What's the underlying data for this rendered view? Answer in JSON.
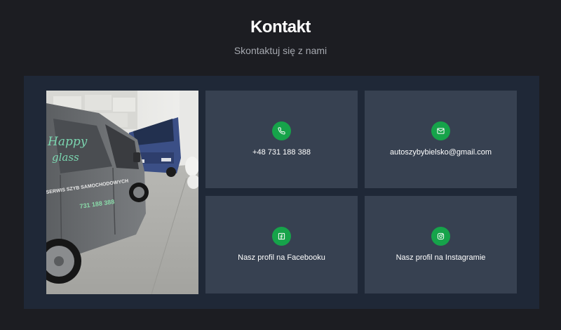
{
  "section": {
    "title": "Kontakt",
    "subtitle": "Skontaktuj się z nami"
  },
  "contacts": [
    {
      "icon": "phone-icon",
      "label": "+48 731 188 388"
    },
    {
      "icon": "mail-icon",
      "label": "autoszybybielsko@gmail.com"
    },
    {
      "icon": "facebook-icon",
      "label": "Nasz profil na Facebooku"
    },
    {
      "icon": "instagram-icon",
      "label": "Nasz profil na Instagramie"
    }
  ],
  "photo": {
    "van_lettering": "Happy glass",
    "van_text": "SERWIS SZYB SAMOCHODOWYCH",
    "van_phone": "731 188 388"
  },
  "colors": {
    "background": "#1c1d22",
    "panel": "#1f2837",
    "card": "#374151",
    "accent": "#16a34a"
  }
}
